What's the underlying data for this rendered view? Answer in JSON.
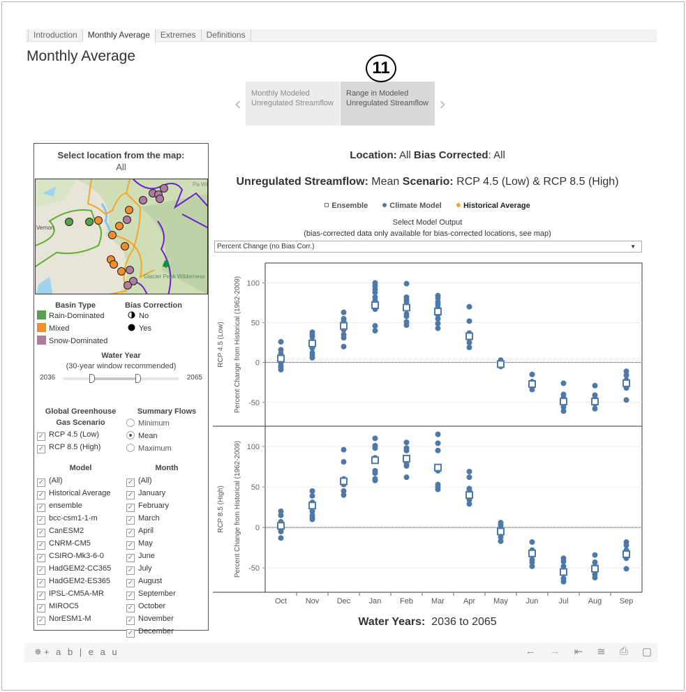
{
  "tabs": [
    {
      "label": "Introduction",
      "active": false
    },
    {
      "label": "Monthly Average",
      "active": true
    },
    {
      "label": "Extremes",
      "active": false
    },
    {
      "label": "Definitions",
      "active": false
    }
  ],
  "page_title": "Monthly Average",
  "annotation_badge": "11",
  "story_points": [
    {
      "label": "Monthly Modeled Unregulated Streamflow",
      "active": false
    },
    {
      "label": "Range in Modeled Unregulated Streamflow",
      "active": true
    }
  ],
  "left_panel": {
    "title": "Select location from the map:",
    "selection": "All",
    "map_labels": {
      "town": "Vernon",
      "wilderness": "Glacier Peak Wilderness",
      "edge": "Pa Wil"
    },
    "basin_type": {
      "header": "Basin Type",
      "items": [
        {
          "label": "Rain-Dominated",
          "color": "#59a14f"
        },
        {
          "label": "Mixed",
          "color": "#f28e2b"
        },
        {
          "label": "Snow-Dominated",
          "color": "#b07aa1"
        }
      ]
    },
    "bias_correction": {
      "header": "Bias Correction",
      "items": [
        {
          "label": "No",
          "icon": "half-circle-icon"
        },
        {
          "label": "Yes",
          "icon": "filled-circle-icon"
        }
      ]
    },
    "water_year": {
      "header": "Water Year",
      "subheader": "(30-year window recommended)",
      "min_label": "2036",
      "max_label": "2065",
      "range_start_fraction": 0.25,
      "range_end_fraction": 0.65
    },
    "scenario": {
      "header_line1": "Global Greenhouse",
      "header_line2": "Gas Scenario",
      "items": [
        {
          "label": "RCP 4.5 (Low)",
          "checked": true
        },
        {
          "label": "RCP 8.5 (High)",
          "checked": true
        }
      ]
    },
    "summary_flows": {
      "header": "Summary Flows",
      "items": [
        {
          "label": "Minimum",
          "selected": false
        },
        {
          "label": "Mean",
          "selected": true
        },
        {
          "label": "Maximum",
          "selected": false
        }
      ]
    },
    "model": {
      "header": "Model",
      "items": [
        "(All)",
        "Historical Average",
        "ensemble",
        "bcc-csm1-1-m",
        "CanESM2",
        "CNRM-CM5",
        "CSIRO-Mk3-6-0",
        "HadGEM2-CC365",
        "HadGEM2-ES365",
        "IPSL-CM5A-MR",
        "MIROC5",
        "NorESM1-M"
      ]
    },
    "month": {
      "header": "Month",
      "items": [
        "(All)",
        "January",
        "February",
        "March",
        "April",
        "May",
        "June",
        "July",
        "August",
        "September",
        "October",
        "November",
        "December"
      ]
    }
  },
  "main": {
    "location_line": {
      "k1": "Location:",
      "v1": " All ",
      "k2": "Bias Corrected",
      "v2": ": All"
    },
    "title_line": {
      "k1": "Unregulated Streamflow:",
      "v1": " Mean ",
      "k2": "Scenario:",
      "v2": " RCP 4.5 (Low) & RCP 8.5 (High)"
    },
    "legend": [
      {
        "label": "Ensemble",
        "marker": "square-icon",
        "color": "#4e79a7"
      },
      {
        "label": "Climate Model",
        "marker": "dot-icon",
        "color": "#4e79a7"
      },
      {
        "label": "Historical Average",
        "marker": "dot-icon",
        "color": "#f5a623"
      }
    ],
    "select_label": "Select Model Output",
    "select_note": "(bias-corrected data only available for bias-corrected locations, see map)",
    "select_value": "Percent Change (no Bias Corr.)",
    "footer_label": "Water Years:",
    "footer_value": "2036 to 2065"
  },
  "chart_data": {
    "type": "scatter",
    "title": "Unregulated Streamflow: Mean Scenario: RCP 4.5 (Low) & RCP 8.5 (High)",
    "xlabel": "Water Years: 2036 to 2065",
    "ylabel": "Percent Change from Historical (1962-2009)",
    "categories": [
      "Oct",
      "Nov",
      "Dec",
      "Jan",
      "Feb",
      "Mar",
      "Apr",
      "May",
      "Jun",
      "Jul",
      "Aug",
      "Sep"
    ],
    "ylim": [
      -80,
      125
    ],
    "yticks": [
      -50,
      0,
      50,
      100
    ],
    "grid": true,
    "reference_line": 0,
    "marker_color": "#4e79a7",
    "panels": [
      {
        "name": "RCP 4.5 (Low)",
        "climate_model": [
          [
            26,
            16,
            11,
            8,
            4,
            0,
            -4,
            -6,
            -9
          ],
          [
            38,
            35,
            32,
            27,
            22,
            18,
            12,
            9,
            6
          ],
          [
            63,
            55,
            52,
            47,
            45,
            41,
            35,
            31,
            20
          ],
          [
            100,
            96,
            92,
            88,
            82,
            78,
            75,
            71,
            67,
            46,
            40
          ],
          [
            99,
            82,
            79,
            76,
            68,
            61,
            58,
            51,
            47
          ],
          [
            84,
            81,
            76,
            73,
            69,
            66,
            60,
            55,
            49,
            43
          ],
          [
            70,
            52,
            37,
            33,
            30,
            25,
            19
          ],
          [
            3,
            1,
            -1,
            -3,
            -5
          ],
          [
            -15,
            -24,
            -26,
            -30,
            -34
          ],
          [
            -26,
            -40,
            -44,
            -49,
            -56,
            -61
          ],
          [
            -29,
            -41,
            -45,
            -48,
            -52,
            -58
          ],
          [
            -11,
            -16,
            -22,
            -25,
            -29,
            -32,
            -47
          ]
        ],
        "ensemble": [
          5,
          24,
          46,
          72,
          69,
          64,
          33,
          -2,
          -27,
          -49,
          -49,
          -26
        ]
      },
      {
        "name": "RCP 8.5 (High)",
        "climate_model": [
          [
            20,
            15,
            7,
            4,
            2,
            0,
            -2,
            -5,
            -13
          ],
          [
            45,
            39,
            31,
            25,
            20,
            15,
            12,
            10
          ],
          [
            96,
            81,
            60,
            56,
            53,
            45,
            40
          ],
          [
            110,
            101,
            98,
            86,
            83,
            70,
            67,
            60,
            58
          ],
          [
            105,
            98,
            95,
            86,
            79,
            76,
            62
          ],
          [
            115,
            104,
            95,
            74,
            70,
            53,
            50,
            47
          ],
          [
            69,
            62,
            48,
            45,
            42,
            38,
            34,
            29
          ],
          [
            6,
            3,
            0,
            -3,
            -5,
            -8,
            -12,
            -17
          ],
          [
            -18,
            -28,
            -32,
            -35,
            -40,
            -43,
            -48
          ],
          [
            -38,
            -42,
            -48,
            -53,
            -57,
            -63,
            -67
          ],
          [
            -34,
            -43,
            -48,
            -53,
            -58,
            -62
          ],
          [
            -18,
            -22,
            -28,
            -32,
            -38,
            -51
          ]
        ],
        "ensemble": [
          2,
          27,
          57,
          83,
          85,
          74,
          40,
          -5,
          -32,
          -55,
          -51,
          -33
        ]
      }
    ],
    "legend": [
      "Ensemble",
      "Climate Model",
      "Historical Average"
    ],
    "legend_position": "top"
  },
  "footer": {
    "logo": "+ a b | e a u",
    "icons": [
      "undo-icon",
      "redo-icon",
      "revert-icon",
      "share-icon",
      "download-icon",
      "fullscreen-icon"
    ]
  }
}
